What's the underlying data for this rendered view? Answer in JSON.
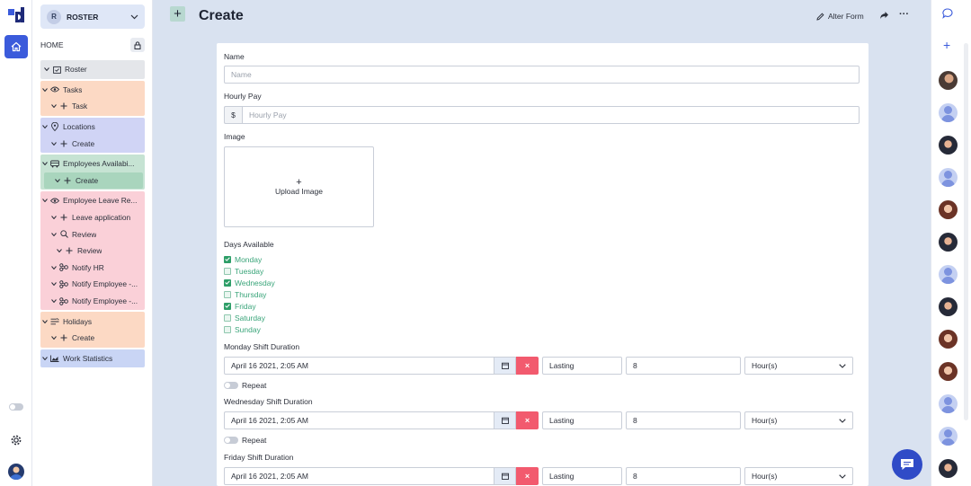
{
  "app": {
    "badge": "R",
    "name": "ROSTER"
  },
  "sidebar": {
    "home_label": "HOME",
    "tree": {
      "roster": "Roster",
      "tasks": "Tasks",
      "tasks_task": "Task",
      "locations": "Locations",
      "locations_create": "Create",
      "employees": "Employees Availabi...",
      "employees_create": "Create",
      "leave": "Employee Leave Re...",
      "leave_application": "Leave application",
      "review": "Review",
      "review_review": "Review",
      "notify_hr": "Notify HR",
      "notify_emp1": "Notify Employee -...",
      "notify_emp2": "Notify Employee -...",
      "holidays": "Holidays",
      "holidays_create": "Create",
      "work_stats": "Work Statistics"
    }
  },
  "header": {
    "title": "Create",
    "alter_form": "Alter Form"
  },
  "form": {
    "name_label": "Name",
    "name_placeholder": "Name",
    "pay_label": "Hourly Pay",
    "pay_prefix": "$",
    "pay_placeholder": "Hourly Pay",
    "image_label": "Image",
    "upload_plus": "+",
    "upload_label": "Upload Image",
    "days_label": "Days Available",
    "days": [
      {
        "name": "Monday",
        "checked": true
      },
      {
        "name": "Tuesday",
        "checked": false
      },
      {
        "name": "Wednesday",
        "checked": true
      },
      {
        "name": "Thursday",
        "checked": false
      },
      {
        "name": "Friday",
        "checked": true
      },
      {
        "name": "Saturday",
        "checked": false
      },
      {
        "name": "Sunday",
        "checked": false
      }
    ],
    "shifts": [
      {
        "title": "Monday Shift Duration",
        "datetime": "April 16 2021, 2:05 AM",
        "lasting": "Lasting",
        "amount": "8",
        "unit": "Hour(s)",
        "repeat": "Repeat"
      },
      {
        "title": "Wednesday Shift Duration",
        "datetime": "April 16 2021, 2:05 AM",
        "lasting": "Lasting",
        "amount": "8",
        "unit": "Hour(s)",
        "repeat": "Repeat"
      },
      {
        "title": "Friday Shift Duration",
        "datetime": "April 16 2021, 2:05 AM",
        "lasting": "Lasting",
        "amount": "8",
        "unit": "Hour(s)"
      }
    ],
    "clear_glyph": "×"
  },
  "colors": {
    "accent": "#3b5bdb",
    "checked_green": "#2e9e68",
    "clear_red": "#f25a6e"
  }
}
